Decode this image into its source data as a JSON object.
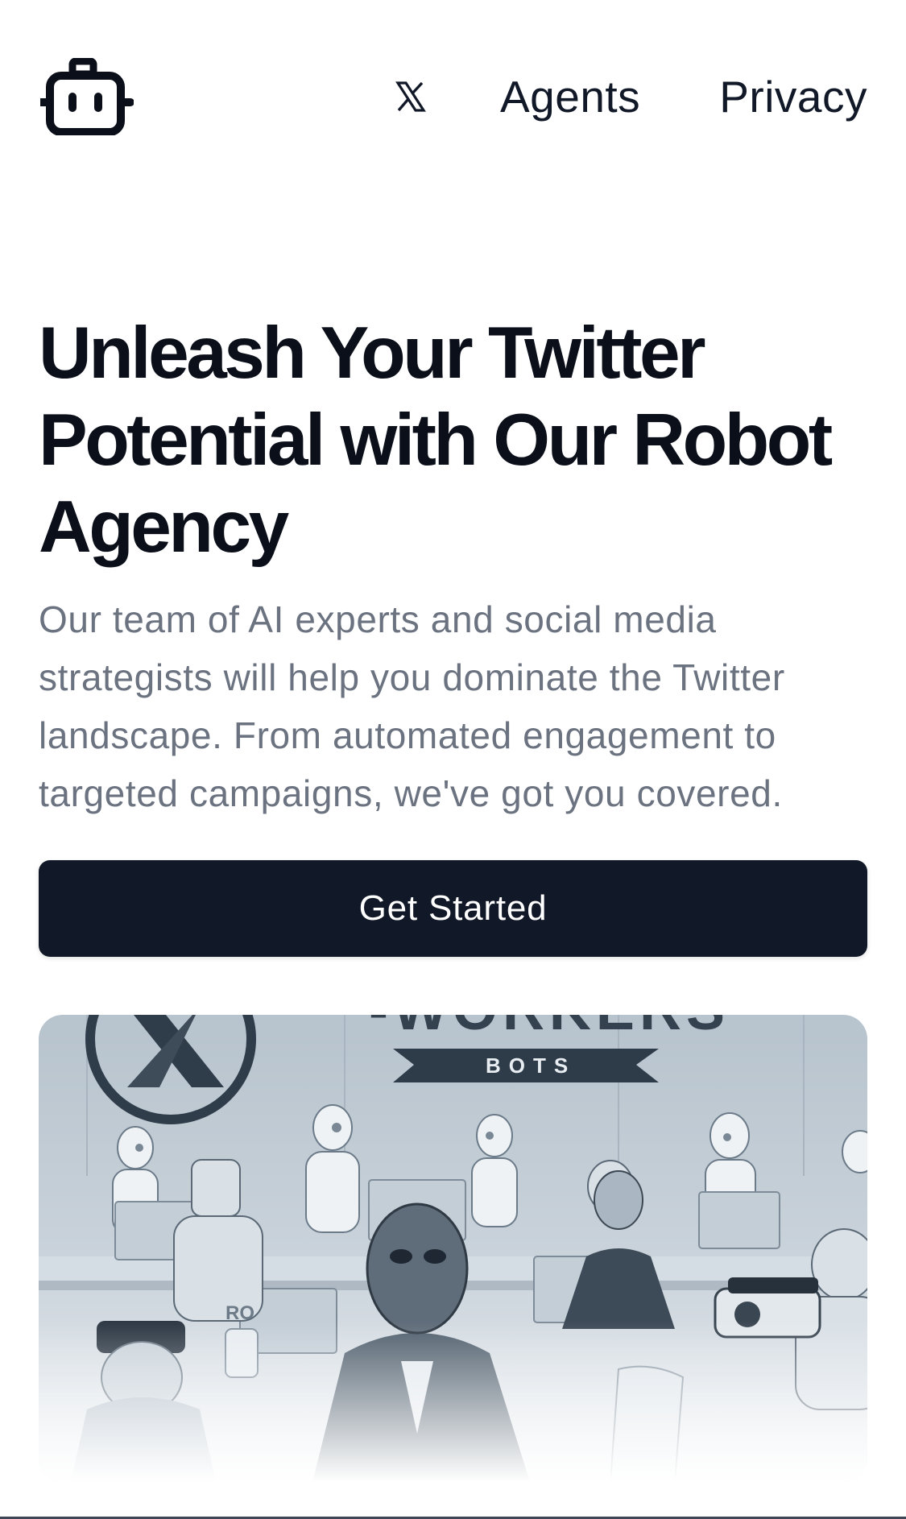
{
  "nav": {
    "links": [
      {
        "label": "Agents"
      },
      {
        "label": "Privacy"
      }
    ],
    "x_glyph": "𝕏"
  },
  "hero": {
    "title": "Unleash Your Twitter Potential with Our Robot Agency",
    "description": "Our team of AI experts and social media strategists will help you dominate the Twitter landscape. From automated engagement to targeted campaigns, we've got you covered.",
    "cta_label": "Get Started"
  },
  "image": {
    "sign_text": "-WORKERS",
    "banner_text": "BOTS",
    "plaque_text": "RO"
  },
  "colors": {
    "primary_dark": "#111827",
    "text_muted": "#6b7280",
    "image_tint": "#93a4b4"
  }
}
